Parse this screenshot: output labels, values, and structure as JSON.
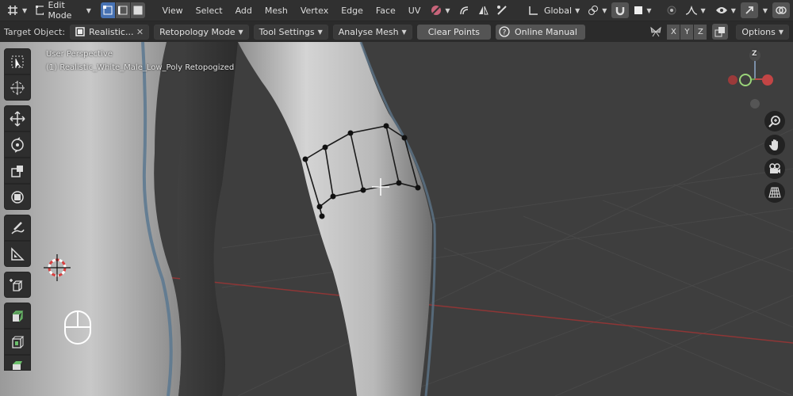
{
  "header": {
    "mode_label": "Edit Mode",
    "menus": [
      "View",
      "Select",
      "Add",
      "Mesh",
      "Vertex",
      "Edge",
      "Face",
      "UV"
    ],
    "transform_orientation": "Global"
  },
  "tool_settings": {
    "target_label": "Target Object:",
    "target_value": "Realistic...",
    "retopo_mode": "Retopology Mode",
    "tool_settings": "Tool Settings",
    "analyse_mesh": "Analyse Mesh",
    "clear_points": "Clear Points",
    "online_manual": "Online Manual",
    "axes": [
      "X",
      "Y",
      "Z"
    ],
    "options": "Options"
  },
  "viewport": {
    "perspective": "User Perspective",
    "object_name": "(1) Realistic_White_Male_Low_Poly Retopogized"
  },
  "gizmo": {
    "z_label": "Z"
  },
  "colors": {
    "header_bg": "#303030",
    "accent": "#4772b3",
    "viewport_bg": "#3d3d3d",
    "x_axis": "#a13a3a"
  }
}
